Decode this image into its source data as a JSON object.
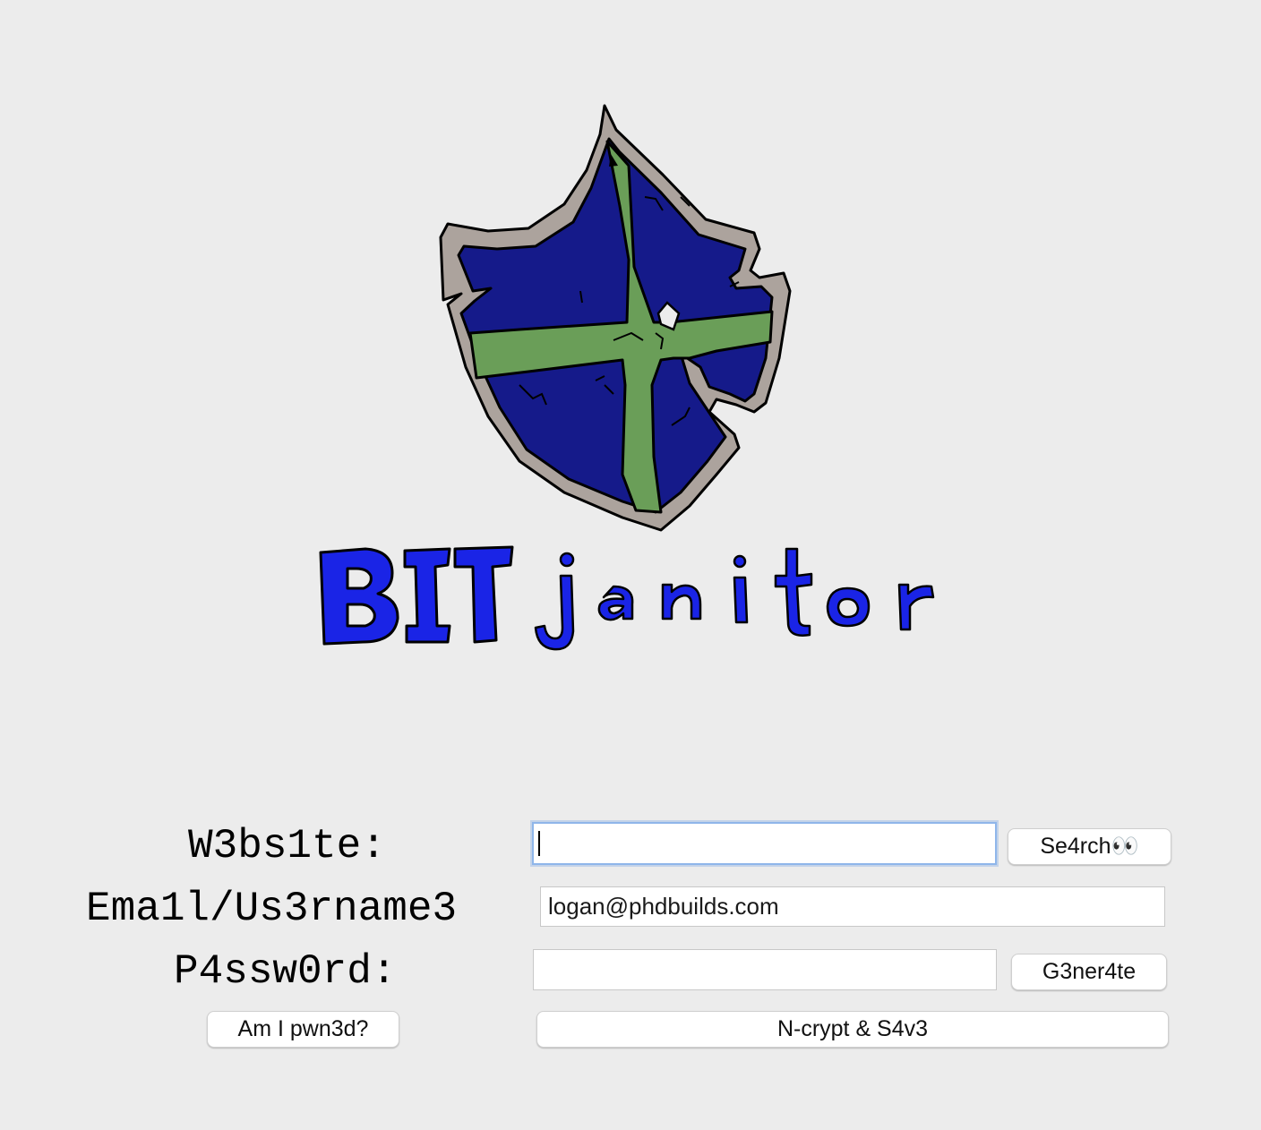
{
  "logo": {
    "wordmark_part1": "BIT",
    "wordmark_part2": "janitor",
    "colors": {
      "shield_blue": "#151a8a",
      "cross_green": "#6a9e58",
      "rim_gray": "#aca39d",
      "wordmark_blue": "#1a24e6"
    }
  },
  "form": {
    "website_label": "W3bs1te:",
    "website_value": "",
    "search_label": "Se4rch👀",
    "email_label": "Ema1l/Us3rname3",
    "email_value": "logan@phdbuilds.com",
    "password_label": "P4ssw0rd:",
    "password_value": "",
    "generate_label": "G3ner4te",
    "pwned_label": "Am I pwn3d?",
    "encrypt_save_label": "N-crypt & S4v3"
  }
}
